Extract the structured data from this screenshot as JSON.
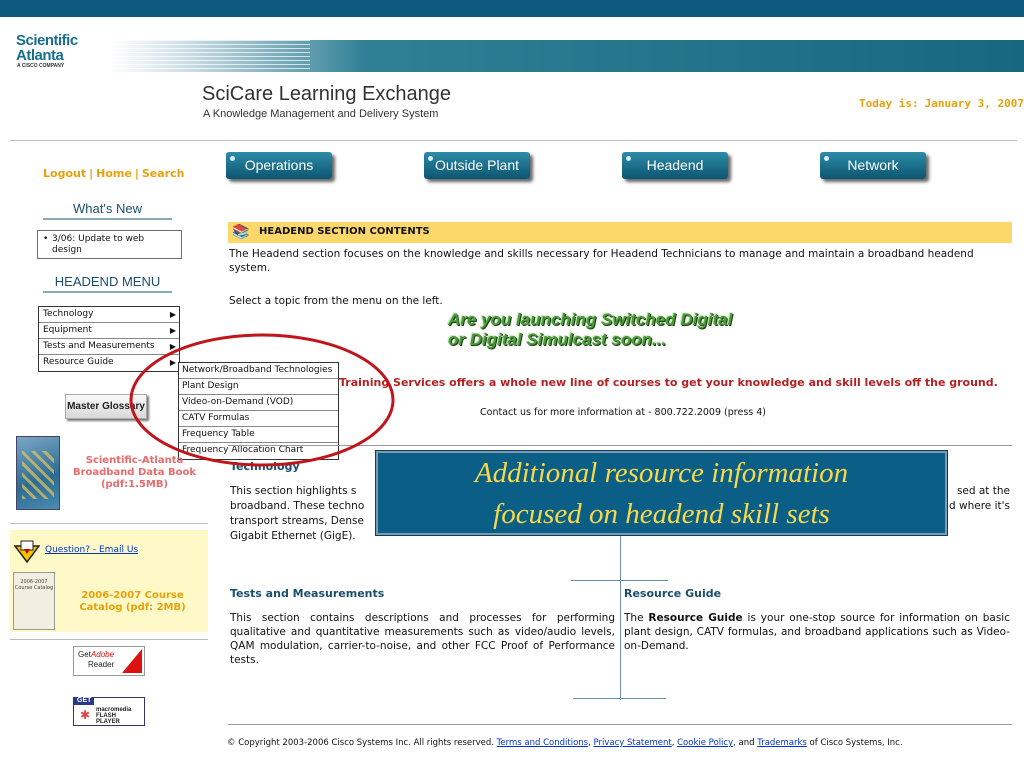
{
  "header": {
    "company_line1": "Scientific",
    "company_line2": "Atlanta",
    "company_sub": "A CISCO COMPANY",
    "app_title": "SciCare Learning Exchange",
    "app_subtitle": "A Knowledge Management and Delivery System",
    "today_label": "Today is:",
    "today_date": "January 3, 2007"
  },
  "top_links": [
    "Logout",
    "Home",
    "Search"
  ],
  "whats_new": {
    "heading": "What's New",
    "items": [
      "3/06: Update to web design"
    ]
  },
  "headend_menu": {
    "heading": "HEADEND MENU",
    "items": [
      {
        "label": "Technology",
        "arrow": "▶"
      },
      {
        "label": "Equipment",
        "arrow": "▶"
      },
      {
        "label": "Tests and Measurements",
        "arrow": "▶"
      },
      {
        "label": "Resource Guide",
        "arrow": "▶"
      }
    ],
    "resource_submenu": [
      "Network/Broadband Technologies",
      "Plant Design",
      "Video-on-Demand (VOD)",
      "CATV Formulas",
      "Frequency Table",
      "Frequency Allocation Chart"
    ]
  },
  "master_glossary": "Master Glossary",
  "databook": "Scientific-Atlanta Broadband Data Book (pdf:1.5MB)",
  "question_link": "Question? - Email Us",
  "catalog": {
    "cover_text": "2006-2007 Course Catalog",
    "link": "2006-2007 Course Catalog (pdf: 2MB)"
  },
  "adobe": {
    "line1": "Get",
    "line2": "Adobe",
    "line3": "Reader"
  },
  "flash": {
    "get": "GET",
    "line1": "macromedia",
    "line2": "FLASH",
    "line3": "PLAYER"
  },
  "nav": [
    "Operations",
    "Outside Plant",
    "Headend",
    "Network"
  ],
  "main": {
    "section_title": "HEADEND SECTION CONTENTS",
    "intro": "The Headend section focuses on the knowledge and skills necessary for Headend Technicians to manage and maintain a broadband headend system.",
    "select_topic": "Select a topic from the menu on the left.",
    "promo_line1": "Are you launching Switched Digital",
    "promo_line2": "or Digital Simulcast soon...",
    "promo_offer": "Training Services offers a whole new line of courses to get your knowledge and skill levels off the ground.",
    "contact": "Contact us for more information at - 800.722.2009 (press 4)",
    "technology": {
      "heading": "Technology",
      "text_start": "This section highlights s",
      "text_line2": "broadband. These techno",
      "text_line3": "transport streams, Dense",
      "text_line4": "Gigabit Ethernet (GigE).",
      "text_right1": "sed at the",
      "text_right2": "d where it's"
    },
    "tests": {
      "heading": "Tests and Measurements",
      "text": "This section contains descriptions and processes for performing qualitative and quantitative measurements such as video/audio levels, QAM modulation, carrier-to-noise, and other FCC Proof of Performance tests."
    },
    "resource": {
      "heading": "Resource Guide",
      "text_pre": "The ",
      "text_bold": "Resource Guide",
      "text_post": " is your one-stop source for information on basic plant design, CATV formulas, and broadband applications such as Video-on-Demand."
    }
  },
  "footer": {
    "copyright": "© Copyright 2003-2006 Cisco Systems Inc. All rights reserved.",
    "links": [
      "Terms and Conditions",
      "Privacy Statement",
      "Cookie Policy",
      "Trademarks"
    ],
    "and": ", and ",
    "suffix": " of Cisco Systems, Inc."
  },
  "callout": {
    "line1": "Additional resource information",
    "line2": "focused on headend skill sets"
  },
  "colors": {
    "brand_teal": "#0e5a7e",
    "accent_orange": "#e7a10b",
    "contents_bar": "#fcd86a",
    "callout_bg": "#0b5f86",
    "callout_text": "#f5d94a",
    "highlight_oval": "#c0151b"
  }
}
